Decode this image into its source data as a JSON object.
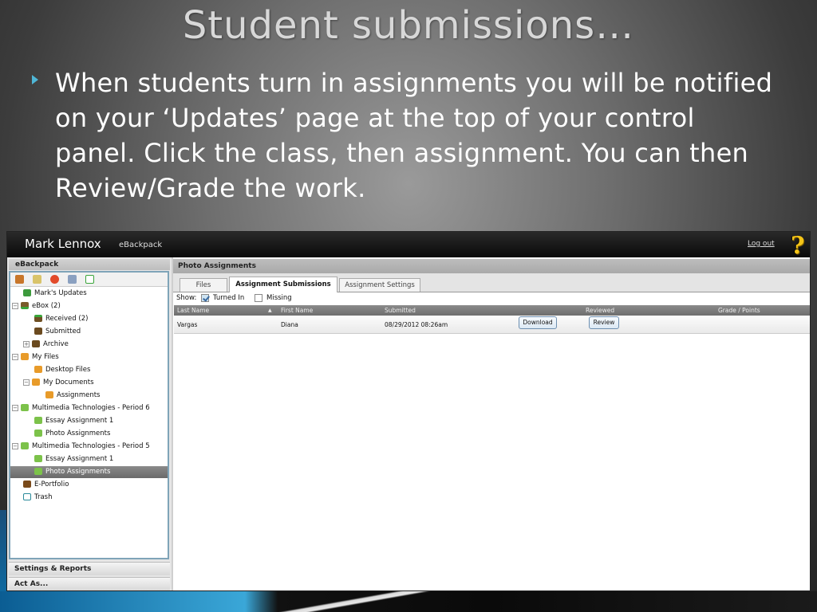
{
  "slide": {
    "title": "Student submissions…",
    "bullet": "When students turn in assignments you will be notified on your ‘Updates’ page at the top of your control panel. Click the class, then assignment. You can then Review/Grade the work."
  },
  "app": {
    "user_name": "Mark Lennox",
    "app_name": "eBackpack",
    "logout": "Log out",
    "help_glyph": "?"
  },
  "sidebar": {
    "title": "eBackpack",
    "tree": {
      "marks_updates": "Mark's Updates",
      "ebox": "eBox (2)",
      "received": "Received (2)",
      "submitted": "Submitted",
      "archive": "Archive",
      "my_files": "My Files",
      "desktop_files": "Desktop Files",
      "my_documents": "My Documents",
      "assignments": "Assignments",
      "mm_period6": "Multimedia Technologies - Period 6",
      "p6_essay": "Essay Assignment 1",
      "p6_photo": "Photo Assignments",
      "mm_period5": "Multimedia Technologies - Period 5",
      "p5_essay": "Essay Assignment 1",
      "p5_photo": "Photo Assignments",
      "eportfolio": "E-Portfolio",
      "trash": "Trash"
    },
    "toggle_minus": "−",
    "toggle_plus": "+",
    "settings_reports": "Settings & Reports",
    "act_as": "Act As..."
  },
  "main": {
    "title": "Photo Assignments",
    "tabs": {
      "files": "Files",
      "submissions": "Assignment Submissions",
      "settings": "Assignment Settings"
    },
    "show_label": "Show:",
    "filter_turned_in": "Turned In",
    "filter_missing": "Missing",
    "columns": {
      "last_name": "Last Name",
      "first_name": "First Name",
      "submitted": "Submitted",
      "reviewed": "Reviewed",
      "grade": "Grade / Points"
    },
    "sort_glyph": "▲",
    "rows": [
      {
        "last_name": "Vargas",
        "first_name": "Diana",
        "submitted": "08/29/2012 08:26am",
        "download_label": "Download",
        "review_label": "Review"
      }
    ]
  },
  "colors": {
    "bullet_accent": "#4fb6d6",
    "help_icon": "#f4c418",
    "selected_row": "#7a7a7a"
  }
}
